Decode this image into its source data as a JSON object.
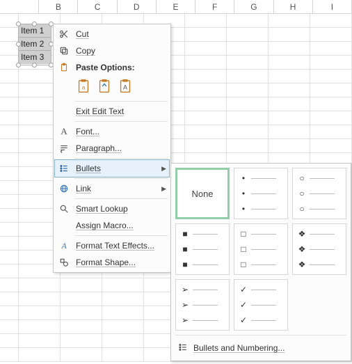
{
  "columns": [
    "B",
    "C",
    "D",
    "E",
    "F",
    "G",
    "H",
    "I"
  ],
  "textbox": {
    "items": [
      "Item 1",
      "Item 2",
      "Item 3"
    ]
  },
  "menu": {
    "cut": "Cut",
    "copy": "Copy",
    "paste_options": "Paste Options:",
    "exit_edit_text": "Exit Edit Text",
    "font": "Font...",
    "paragraph": "Paragraph...",
    "bullets": "Bullets",
    "link": "Link",
    "smart_lookup": "Smart Lookup",
    "assign_macro": "Assign Macro...",
    "format_text_effects": "Format Text Effects...",
    "format_shape": "Format Shape..."
  },
  "bullets_panel": {
    "none": "None",
    "footer": "Bullets and Numbering..."
  }
}
